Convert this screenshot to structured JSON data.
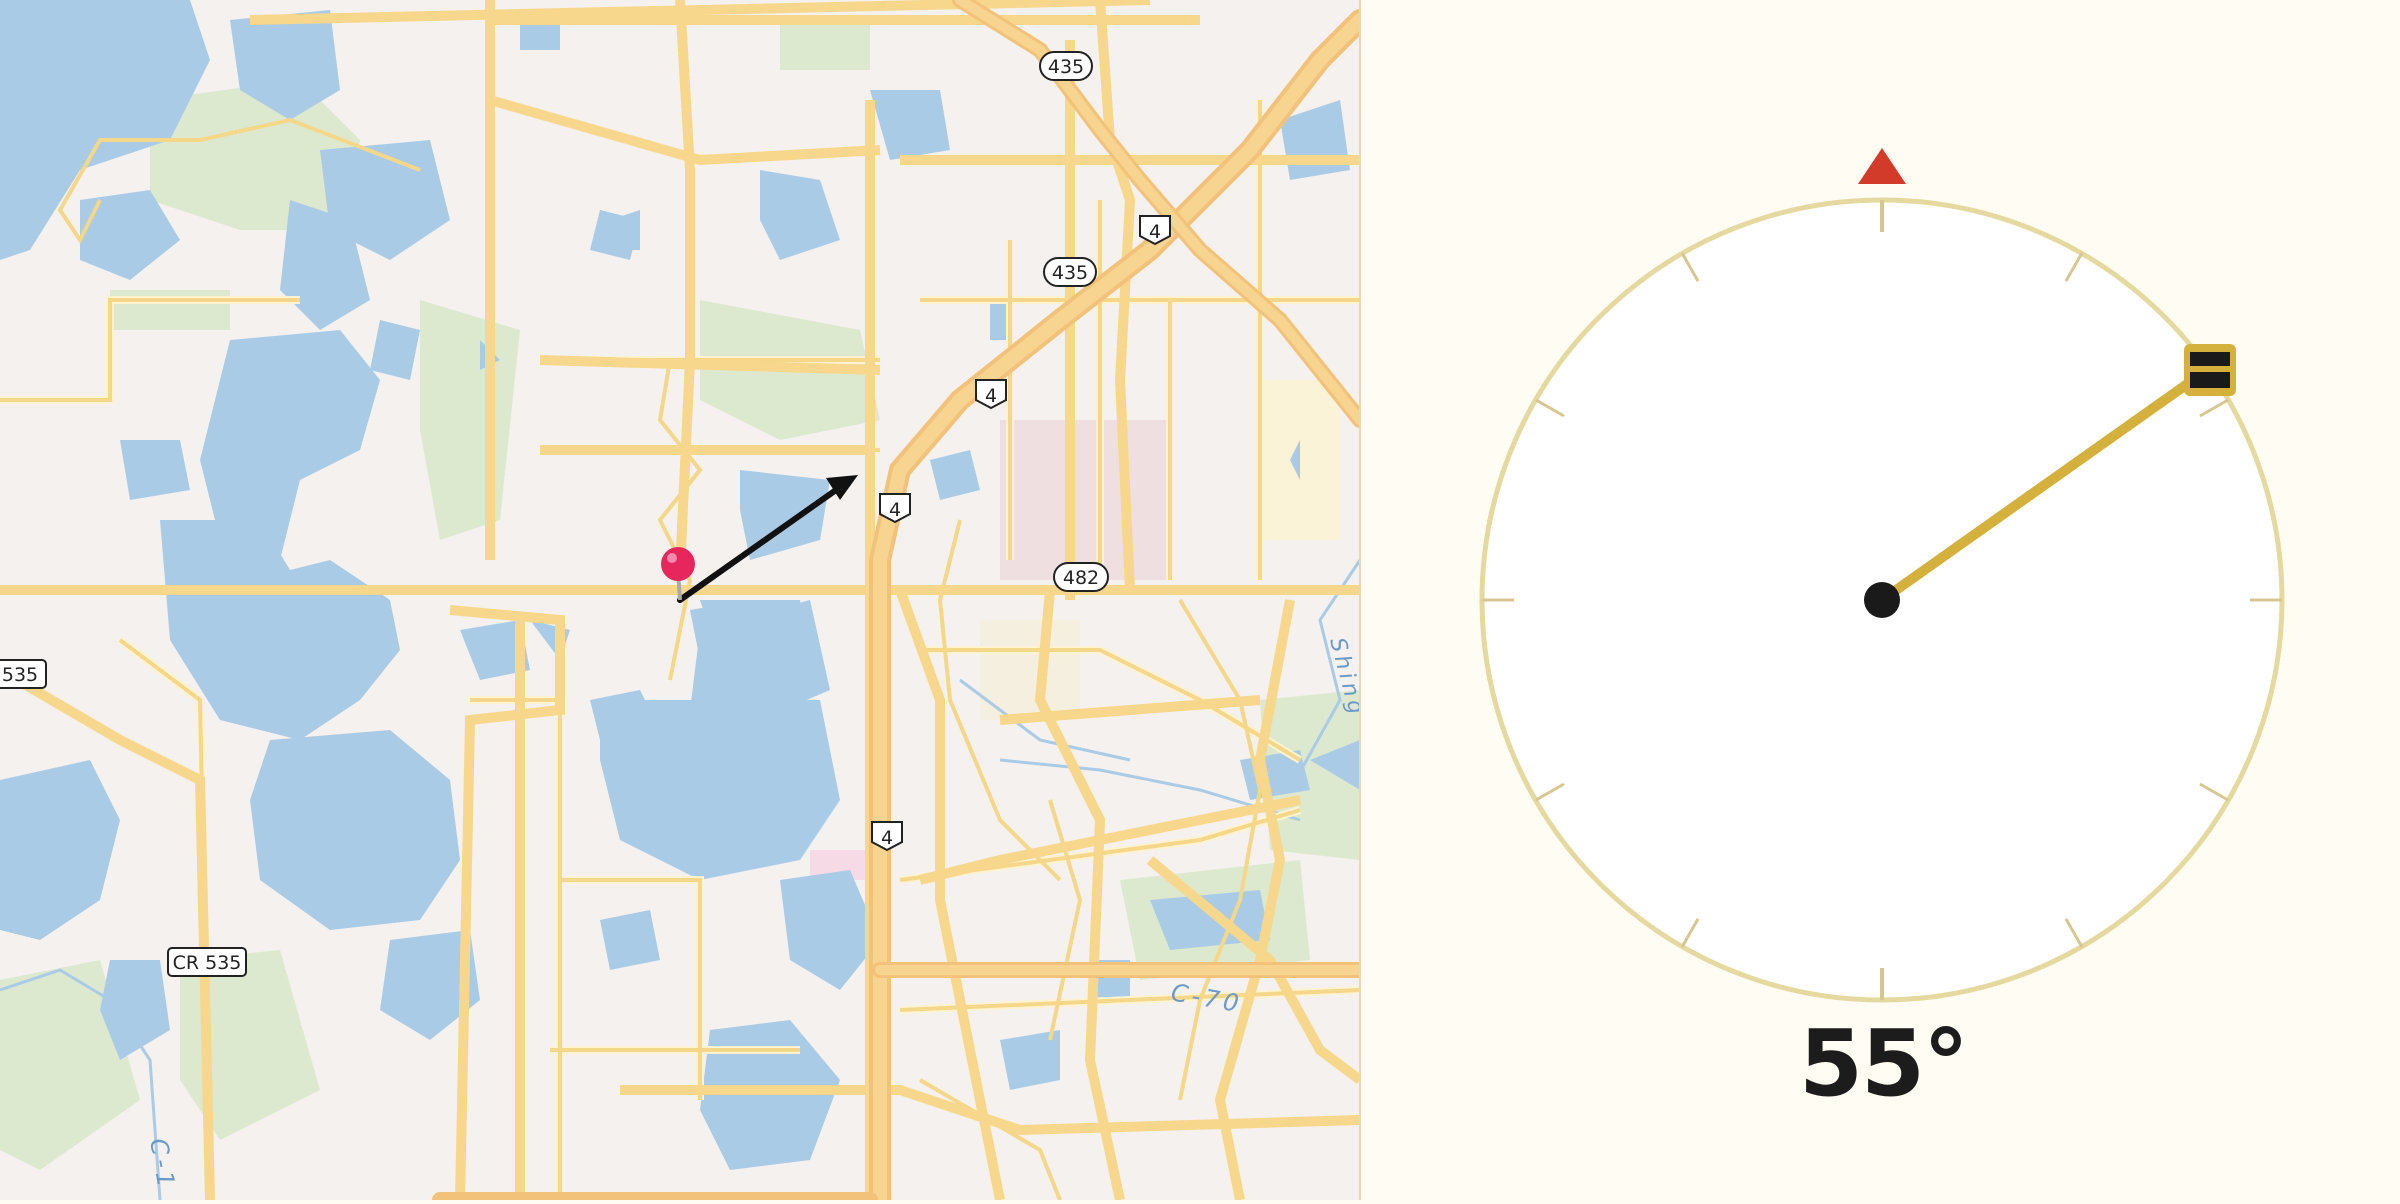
{
  "map": {
    "route_shields": [
      {
        "id": "i435-north",
        "label": "435"
      },
      {
        "id": "i435-mid",
        "label": "435"
      },
      {
        "id": "i4-ne",
        "label": "4"
      },
      {
        "id": "i4-mid",
        "label": "4"
      },
      {
        "id": "i4-center",
        "label": "4"
      },
      {
        "id": "i4-south",
        "label": "4"
      },
      {
        "id": "sr482",
        "label": "482"
      },
      {
        "id": "sr535-west",
        "label": "535"
      },
      {
        "id": "cr535",
        "label": "CR 535"
      }
    ],
    "road_labels": [
      {
        "id": "c-70",
        "label": "C-70"
      },
      {
        "id": "c-1",
        "label": "C-1"
      }
    ],
    "water_labels": [
      {
        "id": "shingle-creek",
        "label": "Shing"
      }
    ],
    "marker": {
      "icon": "map-pin-icon",
      "color": "#e8265e"
    },
    "direction_arrow": {
      "icon": "direction-arrow-icon",
      "color": "#111111"
    }
  },
  "compass": {
    "bearing_deg": 55,
    "bearing_label": "55°",
    "north_marker_color": "#d23a2a",
    "needle_color": "#d4b13c",
    "dial_color": "#e5d9a0",
    "hub_color": "#1a1a1a"
  }
}
